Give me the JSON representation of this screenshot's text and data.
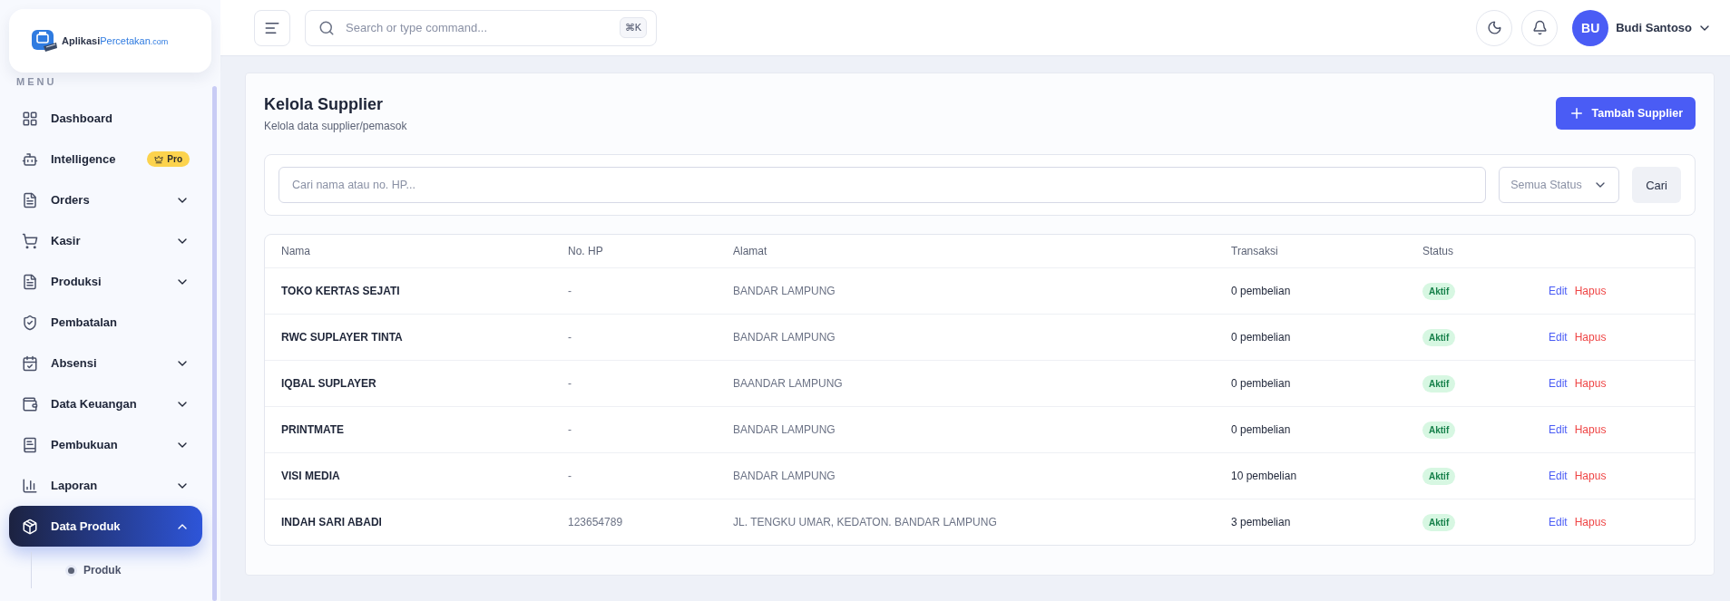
{
  "logo": {
    "parts": [
      "Aplikasi",
      "Percetakan",
      ".com"
    ]
  },
  "sidebar": {
    "section_title": "MENU",
    "items": [
      {
        "label": "Dashboard",
        "kind": "link",
        "selected": false
      },
      {
        "label": "Intelligence",
        "kind": "link",
        "selected": false,
        "badge": "Pro"
      },
      {
        "label": "Orders",
        "kind": "dropdown",
        "selected": false,
        "expanded": false
      },
      {
        "label": "Kasir",
        "kind": "dropdown",
        "selected": false,
        "expanded": false
      },
      {
        "label": "Produksi",
        "kind": "dropdown",
        "selected": false,
        "expanded": false
      },
      {
        "label": "Pembatalan",
        "kind": "link",
        "selected": false
      },
      {
        "label": "Absensi",
        "kind": "dropdown",
        "selected": false,
        "expanded": false
      },
      {
        "label": "Data Keuangan",
        "kind": "dropdown",
        "selected": false,
        "expanded": false
      },
      {
        "label": "Pembukuan",
        "kind": "dropdown",
        "selected": false,
        "expanded": false
      },
      {
        "label": "Laporan",
        "kind": "dropdown",
        "selected": false,
        "expanded": false
      },
      {
        "label": "Data Produk",
        "kind": "dropdown",
        "selected": true,
        "expanded": true,
        "children": [
          {
            "label": "Produk",
            "selected": false
          }
        ]
      }
    ]
  },
  "header": {
    "search": {
      "placeholder": "Search or type command...",
      "shortcut": "⌘K"
    },
    "user": {
      "initials": "BU",
      "name": "Budi Santoso"
    }
  },
  "page": {
    "title": "Kelola Supplier",
    "subtitle": "Kelola data supplier/pemasok",
    "add_button": "Tambah Supplier"
  },
  "filters": {
    "search": {
      "placeholder": "Cari nama atau no. HP..."
    },
    "status_select": {
      "placeholder": "Semua Status"
    },
    "search_button": "Cari"
  },
  "table": {
    "columns": [
      "Nama",
      "No. HP",
      "Alamat",
      "Transaksi",
      "Status"
    ],
    "rows": [
      {
        "name": "TOKO KERTAS SEJATI",
        "phone": "-",
        "address": "BANDAR LAMPUNG",
        "transactions": "0 pembelian",
        "status": "Aktif",
        "actions": [
          "Edit",
          "Hapus"
        ]
      },
      {
        "name": "RWC SUPLAYER TINTA",
        "phone": "-",
        "address": "BANDAR LAMPUNG",
        "transactions": "0 pembelian",
        "status": "Aktif",
        "actions": [
          "Edit",
          "Hapus"
        ]
      },
      {
        "name": "IQBAL SUPLAYER",
        "phone": "-",
        "address": "BAANDAR LAMPUNG",
        "transactions": "0 pembelian",
        "status": "Aktif",
        "actions": [
          "Edit",
          "Hapus"
        ]
      },
      {
        "name": "PRINTMATE",
        "phone": "-",
        "address": "BANDAR LAMPUNG",
        "transactions": "0 pembelian",
        "status": "Aktif",
        "actions": [
          "Edit",
          "Hapus"
        ]
      },
      {
        "name": "VISI MEDIA",
        "phone": "-",
        "address": "BANDAR LAMPUNG",
        "transactions": "10 pembelian",
        "status": "Aktif",
        "actions": [
          "Edit",
          "Hapus"
        ]
      },
      {
        "name": "INDAH SARI ABADI",
        "phone": "123654789",
        "address": "JL. TENGKU UMAR, KEDATON. BANDAR LAMPUNG",
        "transactions": "3 pembelian",
        "status": "Aktif",
        "actions": [
          "Edit",
          "Hapus"
        ]
      }
    ]
  }
}
